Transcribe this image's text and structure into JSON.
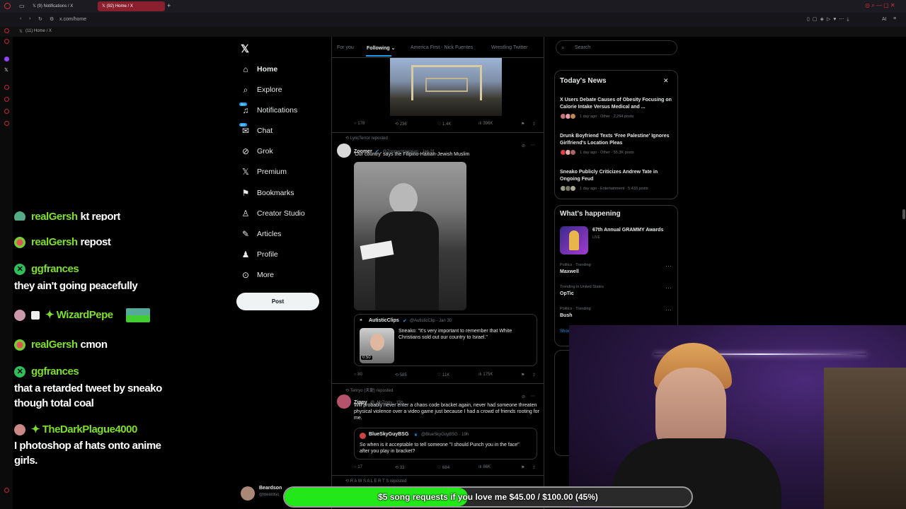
{
  "browser": {
    "tabs": [
      {
        "label": "(9) Notifications / X"
      },
      {
        "label": "(92) Home / X"
      }
    ],
    "url": "x.com/home",
    "bookmark": "(11) Home / X",
    "toolbar_text": "AI"
  },
  "chat": [
    {
      "user": "realGersh",
      "text": "kt report"
    },
    {
      "user": "realGersh",
      "text": "repost"
    },
    {
      "user": "ggfrances",
      "text": "they ain't going peacefully"
    },
    {
      "user": "WizardPepe",
      "text": ""
    },
    {
      "user": "realGersh",
      "text": "cmon"
    },
    {
      "user": "ggfrances",
      "text": "that a retarded tweet by sneako",
      "text2": "though total coal"
    },
    {
      "user": "TheDarkPlague4000",
      "text": "I photoshop af hats onto anime",
      "text2": "girls."
    }
  ],
  "nav": {
    "items": [
      {
        "label": "Home",
        "icon": "home-icon"
      },
      {
        "label": "Explore",
        "icon": "search-icon"
      },
      {
        "label": "Notifications",
        "icon": "bell-icon",
        "badge": "20+"
      },
      {
        "label": "Chat",
        "icon": "mail-icon",
        "badge": "20+"
      },
      {
        "label": "Grok",
        "icon": "grok-icon"
      },
      {
        "label": "Premium",
        "icon": "x-logo-icon"
      },
      {
        "label": "Bookmarks",
        "icon": "bookmark-icon"
      },
      {
        "label": "Creator Studio",
        "icon": "creator-icon"
      },
      {
        "label": "Articles",
        "icon": "articles-icon"
      },
      {
        "label": "Profile",
        "icon": "person-icon"
      },
      {
        "label": "More",
        "icon": "more-circle-icon"
      }
    ],
    "post_label": "Post",
    "account_name": "Beardson",
    "account_handle": "@Beardson"
  },
  "feed": {
    "tabs": [
      "For you",
      "Following",
      "America First - Nick Fuentes",
      "Wrestling Twitter"
    ],
    "active_tab": "Following",
    "tweet0_stats": {
      "replies": "178",
      "reposts": "236",
      "likes": "1.4K",
      "views": "396K"
    },
    "tweet1": {
      "repost_by": "LyricTerror reposted",
      "name": "Zoomer",
      "handle_date": "@ZoomerHistorian · Jan 31",
      "text": "'Our country' says the Filipino-Haitian-Jewish Muslim",
      "quote_name": "AutisticClips",
      "quote_handle_date": "@AutisticClip · Jan 30",
      "quote_text": "Sneako: \"It's very important to remember that White Christians sold out our country to Israel.\"",
      "video_time": "0:50",
      "stats": {
        "replies": "80",
        "reposts": "585",
        "likes": "11K",
        "views": "175K"
      }
    },
    "tweet2": {
      "repost_by": "Tenryo (天龍) reposted",
      "name": "Zippy",
      "handle_date": "@_MrZippy · 15h",
      "text": "Will probably never enter a chaos code bracket again, never had someone threaten physical violence over a video game just because I had a crowd of friends rooting for me.",
      "quote_name": "BlueSkyGuyBSG",
      "quote_handle_date": "@BlueSkyGuyBSG · 19h",
      "quote_text": "So when is it acceptable to tell someone \"I should Punch you in the face\" after you play in bracket?",
      "stats": {
        "replies": "17",
        "reposts": "33",
        "likes": "684",
        "views": "86K"
      }
    },
    "next_repost": "R A W S A L E R T S reposted"
  },
  "right": {
    "search_placeholder": "Search",
    "news_title": "Today's News",
    "news": [
      {
        "title": "X Users Debate Causes of Obesity Focusing on Calorie Intake Versus Medical and ...",
        "meta": "1 day ago · Other · 2,294 posts"
      },
      {
        "title": "Drunk Boyfriend Texts 'Free Palestine' Ignores Girlfriend's Location Pleas",
        "meta": "1 day ago · Other · 55.3K posts"
      },
      {
        "title": "Sneako Publicly Criticizes Andrew Tate in Ongoing Feud",
        "meta": "1 day ago · Entertainment · 5,433 posts"
      }
    ],
    "happening_title": "What's happening",
    "event_title": "67th Annual GRAMMY Awards",
    "event_status": "LIVE",
    "trends": [
      {
        "context": "Politics · Trending",
        "name": "Maxwell"
      },
      {
        "context": "Trending in United States",
        "name": "OpTic"
      },
      {
        "context": "Politics · Trending",
        "name": "Bush"
      }
    ],
    "show_more": "Show"
  },
  "goal": {
    "text": "$5 song requests if you love me $45.00 / $100.00 (45%)",
    "percent": 45
  },
  "colors": {
    "accent": "#1d9bf0",
    "goal_fill": "#22e81a",
    "chat_name": "#7ddf2a",
    "tab_active": "#8a1f2d"
  }
}
